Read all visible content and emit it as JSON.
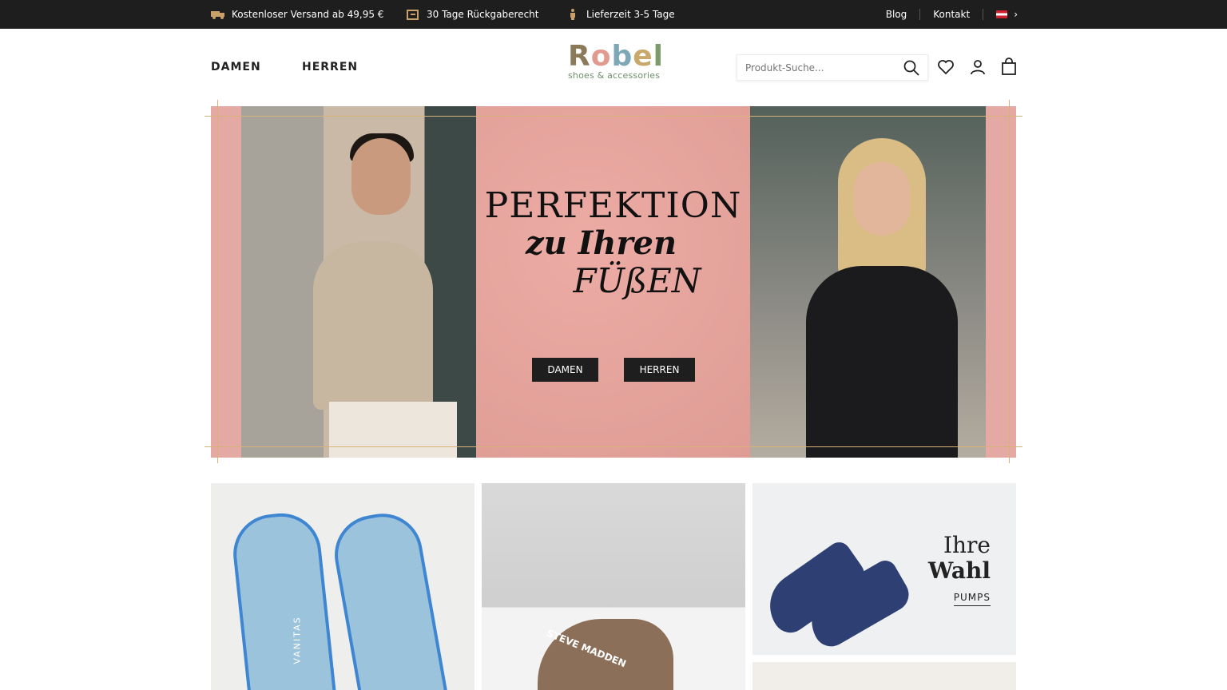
{
  "topbar": {
    "usps": [
      {
        "icon": "truck-icon",
        "text": "Kostenloser Versand ab 49,95 €"
      },
      {
        "icon": "return-box-icon",
        "text": "30 Tage Rückgaberecht"
      },
      {
        "icon": "delivery-person-icon",
        "text": "Lieferzeit 3-5 Tage"
      }
    ],
    "blog": "Blog",
    "kontakt": "Kontakt",
    "country_flag": "austria-flag-icon"
  },
  "header": {
    "nav": [
      "DAMEN",
      "HERREN"
    ],
    "logo": {
      "word": "Robel",
      "sub": "shoes & accessories"
    },
    "search_placeholder": "Produkt-Suche..."
  },
  "hero": {
    "line1": "PERFEKTION",
    "line2": "zu Ihren",
    "line3": "FÜßEN",
    "btn_damen": "DAMEN",
    "btn_herren": "HERREN"
  },
  "tiles": {
    "tile3": {
      "line1": "Ihre",
      "line2": "Wahl",
      "cta": "PUMPS"
    },
    "tile2_label": "STEVE MADDEN",
    "tile1_label": "VANITAS"
  },
  "colors": {
    "topbar_bg": "#1e1e1e",
    "hero_pink": "#e4a9a3",
    "frame_gold": "#d7b37a"
  }
}
